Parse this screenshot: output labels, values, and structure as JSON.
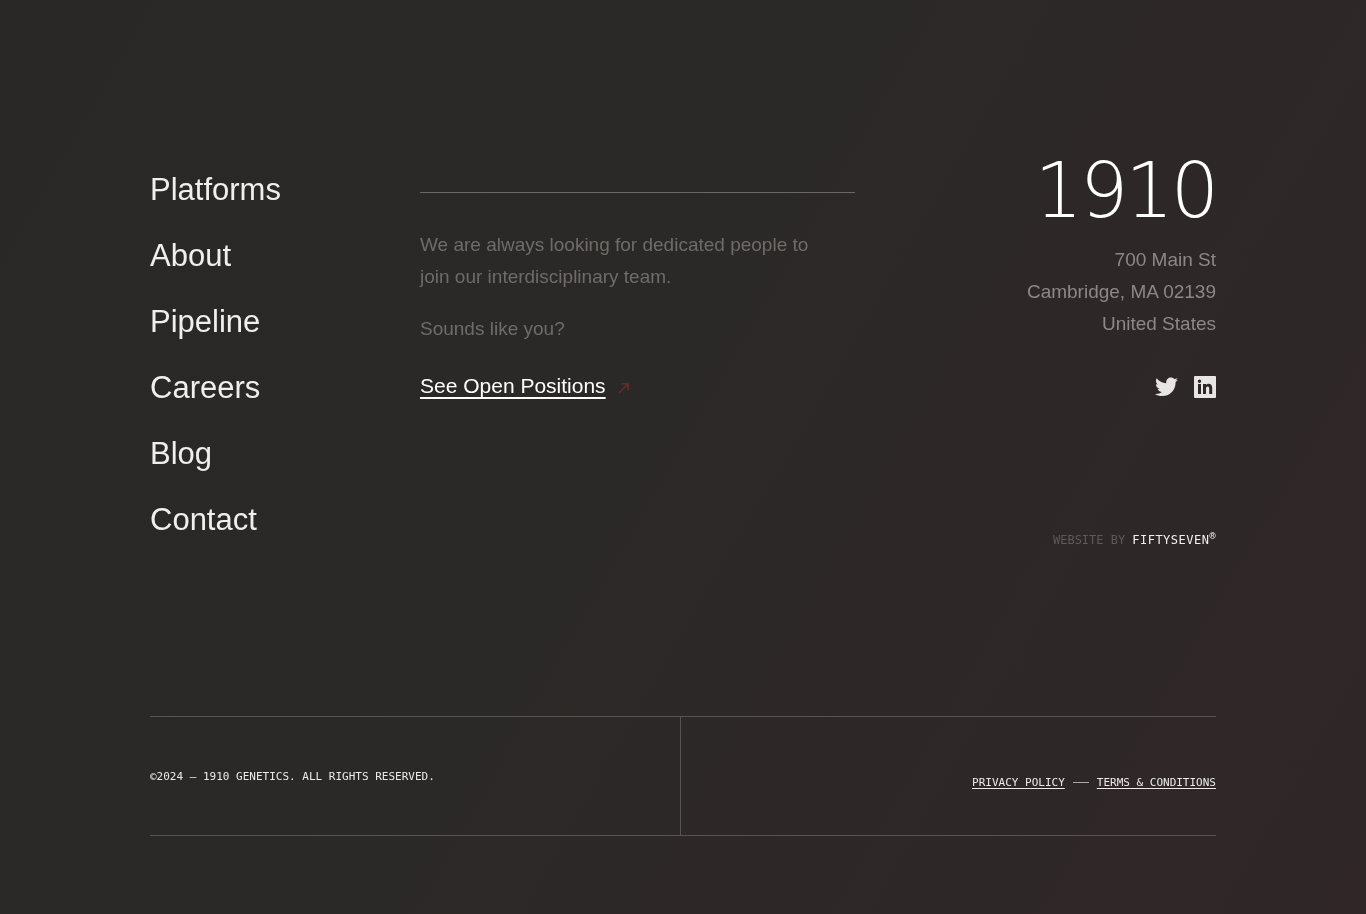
{
  "nav": [
    "Platforms",
    "About",
    "Pipeline",
    "Careers",
    "Blog",
    "Contact"
  ],
  "careers": {
    "text": "We are always looking for dedicated people to join our interdisciplinary team.",
    "prompt": "Sounds like you?",
    "link": "See Open Positions"
  },
  "logo": "1910",
  "address": [
    "700 Main St",
    "Cambridge, MA 02139",
    "United States"
  ],
  "credit": {
    "label": "WEBSITE BY",
    "name": "FIFTYSEVEN$^{®}$"
  },
  "copyright": "©2024 — 1910 GENETICS. ALL RIGHTS RESERVED.",
  "legal_links": [
    "PRIVACY POLICY",
    "TERMS & CONDITIONS"
  ]
}
